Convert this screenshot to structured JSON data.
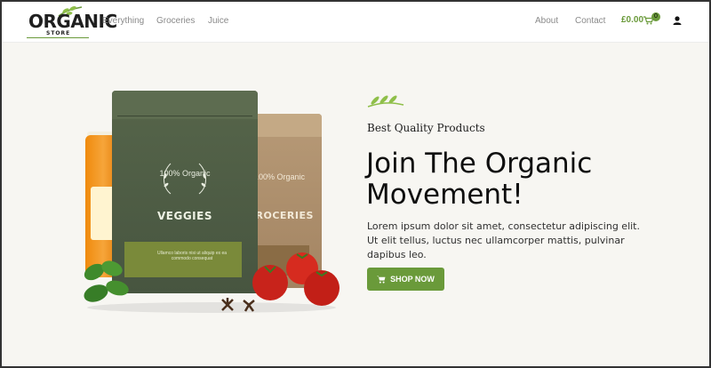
{
  "header": {
    "logo_text": "ORGANIC",
    "logo_sub": "STORE",
    "nav_left": [
      "Everything",
      "Groceries",
      "Juice"
    ],
    "nav_right": [
      "About",
      "Contact"
    ],
    "cart_price": "£0.00",
    "cart_count": "0"
  },
  "product_art": {
    "green_bag_label": "VEGGIES",
    "green_bag_stamp": "100% Organic",
    "green_bag_fine_print": "Ullamco laboris nisi ut aliquip ex ea commodo consequat",
    "tan_bag_label": "GROCERIES",
    "tan_bag_stamp": "100% Organic"
  },
  "hero": {
    "eyebrow": "Best Quality Products",
    "headline": "Join The Organic Movement!",
    "body": "Lorem ipsum dolor sit amet, consectetur adipiscing elit. Ut elit tellus, luctus nec ullamcorper mattis, pulvinar dapibus leo.",
    "cta_label": "SHOP NOW"
  },
  "colors": {
    "accent": "#6a9a3a",
    "background": "#f7f6f2",
    "header_bg": "#ffffff",
    "text_dark": "#0e0e0e",
    "nav_text": "#8a8a8a"
  },
  "icons": [
    "leaf-icon",
    "cart-icon",
    "user-icon",
    "shopping-cart-icon"
  ]
}
